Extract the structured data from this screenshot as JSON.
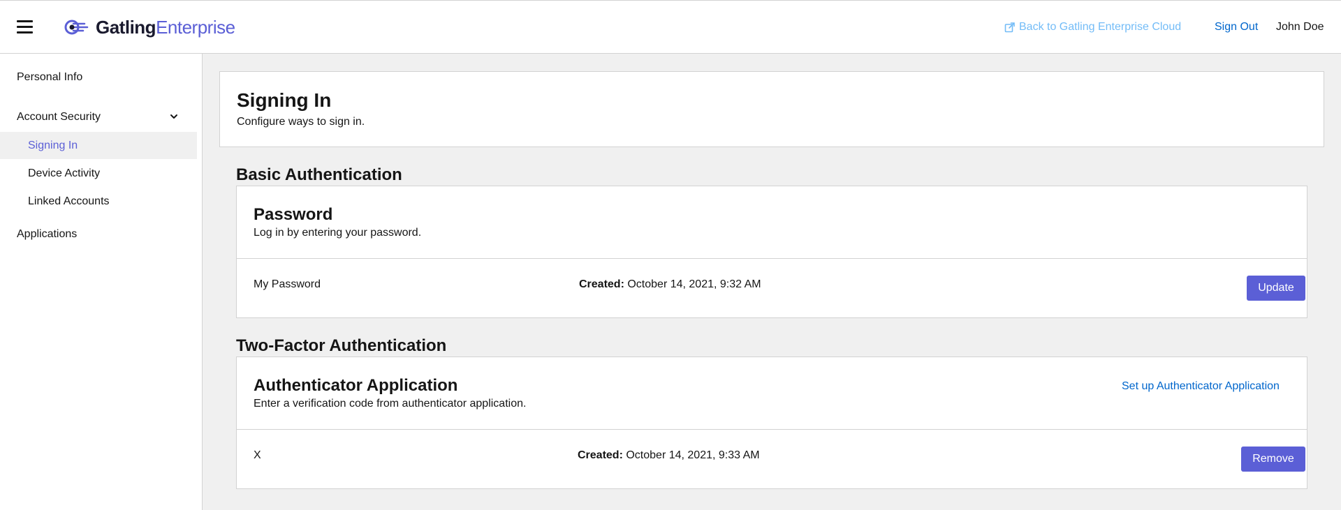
{
  "header": {
    "logo_bold": "Gatling",
    "logo_light": "Enterprise",
    "back_link": "Back to Gatling Enterprise Cloud",
    "sign_out": "Sign Out",
    "username": "John Doe"
  },
  "sidebar": {
    "personal_info": "Personal Info",
    "account_security": "Account Security",
    "sub_items": [
      "Signing In",
      "Device Activity",
      "Linked Accounts"
    ],
    "applications": "Applications"
  },
  "main": {
    "title": "Signing In",
    "subtitle": "Configure ways to sign in.",
    "basic": {
      "section": "Basic Authentication",
      "card_title": "Password",
      "card_desc": "Log in by entering your password.",
      "row_name": "My Password",
      "created_label": "Created:",
      "created_value": "October 14, 2021, 9:32 AM",
      "button": "Update"
    },
    "twofactor": {
      "section": "Two-Factor Authentication",
      "card_title": "Authenticator Application",
      "card_desc": "Enter a verification code from authenticator application.",
      "setup_link": "Set up Authenticator Application",
      "row_name": "X",
      "created_label": "Created:",
      "created_value": "October 14, 2021, 9:33 AM",
      "button": "Remove"
    }
  },
  "colors": {
    "accent": "#5b5fd6",
    "link": "#0066cc",
    "link_light": "#73bcf7"
  }
}
